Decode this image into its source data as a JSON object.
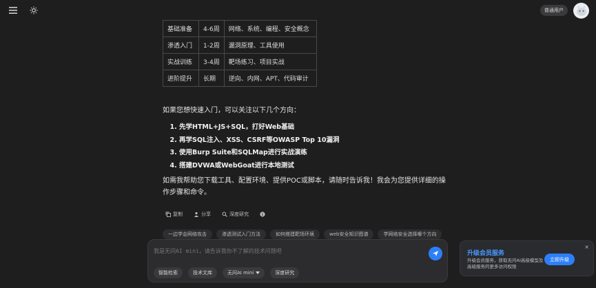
{
  "topbar": {
    "menu_icon": "menu-icon",
    "theme_icon": "sun-icon",
    "user_badge": "普通用户",
    "avatar_icon": "avatar-icon"
  },
  "table": {
    "rows": [
      [
        "基础准备",
        "4-6周",
        "网络、系统、编程、安全概念"
      ],
      [
        "渗透入门",
        "1-2周",
        "漏洞原理、工具使用"
      ],
      [
        "实战训练",
        "3-4周",
        "靶场练习、项目实战"
      ],
      [
        "进阶提升",
        "长期",
        "逆向、内网、APT、代码审计"
      ]
    ]
  },
  "message": {
    "intro": "如果您想快速入门，可以关注以下几个方向：",
    "steps": [
      "先学HTML+JS+SQL，打好Web基础",
      "再学SQL注入、XSS、CSRF等OWASP Top 10漏洞",
      "使用Burp Suite和SQLMap进行实战演练",
      "搭建DVWA或WebGoat进行本地测试"
    ],
    "closing": "如需我帮助您下载工具、配置环境、提供POC或脚本，请随时告诉我！我会为您提供详细的操作步骤和命令。"
  },
  "actions": {
    "copy": "复制",
    "share": "分享",
    "research": "深度研究",
    "info_icon": "info-icon"
  },
  "suggestions": [
    "一边学会网络攻击",
    "渗透测试入门方法",
    "如何搭建靶场环境",
    "web安全知识图谱",
    "学网络安全选择哪个方向"
  ],
  "input": {
    "placeholder": "我是无问AI mini，请告诉我你不了解的技术问题吧",
    "send_icon": "send-icon"
  },
  "tools": {
    "smart_search": "智能检索",
    "tech_library": "技术文库",
    "model_select": "无问AI mini",
    "deep_research": "深度研究"
  },
  "promo": {
    "title": "升级会员服务",
    "description": "升级会员服务，获取无问AI高级模型及高级服务的更多访问权限",
    "button": "立即升级",
    "close": "×"
  },
  "colors": {
    "background": "#1e1e1f",
    "accent": "#2d7ff9",
    "promo_title": "#4a98ff"
  }
}
